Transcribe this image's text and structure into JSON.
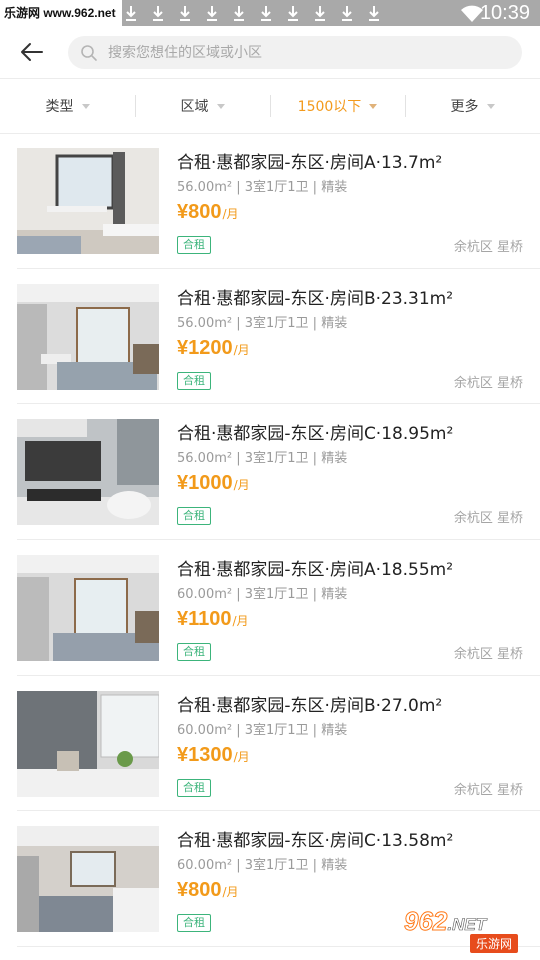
{
  "status_bar": {
    "watermark": "乐游网 www.962.net",
    "time": "10:39",
    "download_icon_count": 10
  },
  "header": {
    "search_placeholder": "搜索您想住的区域或小区"
  },
  "filters": [
    {
      "label": "类型",
      "active": false
    },
    {
      "label": "区域",
      "active": false
    },
    {
      "label": "1500以下",
      "active": true
    },
    {
      "label": "更多",
      "active": false
    }
  ],
  "listings": [
    {
      "title": "合租·惠都家园-东区·房间A·13.7m²",
      "meta": "56.00m² | 3室1厅1卫 | 精装",
      "price": "¥800",
      "unit": "/月",
      "tag": "合租",
      "location": "余杭区 星桥"
    },
    {
      "title": "合租·惠都家园-东区·房间B·23.31m²",
      "meta": "56.00m² | 3室1厅1卫 | 精装",
      "price": "¥1200",
      "unit": "/月",
      "tag": "合租",
      "location": "余杭区 星桥"
    },
    {
      "title": "合租·惠都家园-东区·房间C·18.95m²",
      "meta": "56.00m² | 3室1厅1卫 | 精装",
      "price": "¥1000",
      "unit": "/月",
      "tag": "合租",
      "location": "余杭区 星桥"
    },
    {
      "title": "合租·惠都家园-东区·房间A·18.55m²",
      "meta": "60.00m² | 3室1厅1卫 | 精装",
      "price": "¥1100",
      "unit": "/月",
      "tag": "合租",
      "location": "余杭区 星桥"
    },
    {
      "title": "合租·惠都家园-东区·房间B·27.0m²",
      "meta": "60.00m² | 3室1厅1卫 | 精装",
      "price": "¥1300",
      "unit": "/月",
      "tag": "合租",
      "location": "余杭区 星桥"
    },
    {
      "title": "合租·惠都家园-东区·房间C·13.58m²",
      "meta": "60.00m² | 3室1厅1卫 | 精装",
      "price": "¥800",
      "unit": "/月",
      "tag": "合租",
      "location": ""
    }
  ],
  "logo": {
    "brand": "962",
    "suffix": ".NET",
    "subtitle": "乐游网"
  },
  "colors": {
    "accent": "#f39a1c",
    "tag_green": "#3cb47b",
    "status_bar": "#a9a9a9"
  }
}
